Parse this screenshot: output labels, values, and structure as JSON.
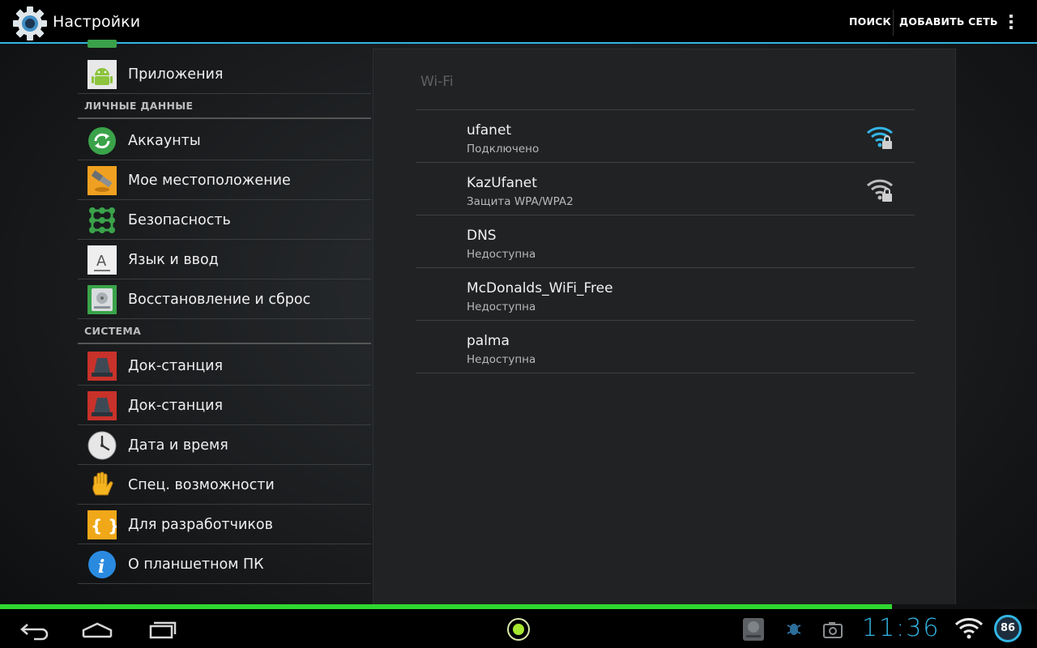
{
  "actionbar": {
    "title": "Настройки",
    "search_label": "ПОИСК",
    "add_network_label": "ДОБАВИТЬ СЕТЬ",
    "accent": "#33b5e5"
  },
  "settings": {
    "apps_label": "Приложения",
    "personal_header": "ЛИЧНЫЕ ДАННЫЕ",
    "personal_items": [
      {
        "label": "Аккаунты",
        "icon": "sync-icon"
      },
      {
        "label": "Мое местоположение",
        "icon": "location-satellite-icon"
      },
      {
        "label": "Безопасность",
        "icon": "lock-pattern-icon"
      },
      {
        "label": "Язык и ввод",
        "icon": "keyboard-icon"
      },
      {
        "label": "Восстановление и сброс",
        "icon": "backup-drive-icon"
      }
    ],
    "system_header": "СИСТЕМА",
    "system_items": [
      {
        "label": "Док-станция",
        "icon": "dock-icon"
      },
      {
        "label": "Док-станция",
        "icon": "dock-icon"
      },
      {
        "label": "Дата и время",
        "icon": "clock-icon"
      },
      {
        "label": "Спец. возможности",
        "icon": "hand-icon"
      },
      {
        "label": "Для разработчиков",
        "icon": "braces-icon"
      },
      {
        "label": "О планшетном ПК",
        "icon": "info-icon"
      }
    ]
  },
  "wifi": {
    "title": "Wi-Fi",
    "networks": [
      {
        "name": "ufanet",
        "status": "Подключено",
        "signal_icon": "wifi-lock-connected-icon"
      },
      {
        "name": "KazUfanet",
        "status": "Защита WPA/WPA2",
        "signal_icon": "wifi-lock-icon"
      },
      {
        "name": "DNS",
        "status": "Недоступна"
      },
      {
        "name": "McDonalds_WiFi_Free",
        "status": "Недоступна"
      },
      {
        "name": "palma",
        "status": "Недоступна"
      }
    ]
  },
  "status_bar": {
    "time": "11:36",
    "battery": "86",
    "progress_fraction": 0.86,
    "progress_color": "#2fd72f"
  }
}
